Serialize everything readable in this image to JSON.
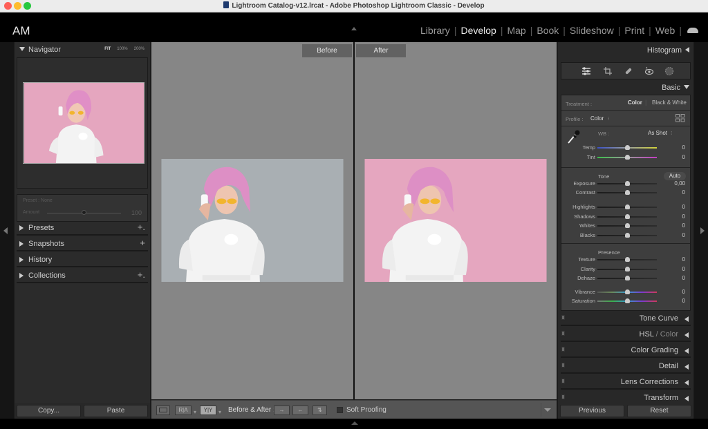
{
  "window": {
    "title": "Lightroom Catalog-v12.lrcat - Adobe Photoshop Lightroom Classic - Develop"
  },
  "header": {
    "identity_plate": "AM",
    "modules": [
      {
        "label": "Library",
        "active": false
      },
      {
        "label": "Develop",
        "active": true
      },
      {
        "label": "Map",
        "active": false
      },
      {
        "label": "Book",
        "active": false
      },
      {
        "label": "Slideshow",
        "active": false
      },
      {
        "label": "Print",
        "active": false
      },
      {
        "label": "Web",
        "active": false
      }
    ],
    "cloud_icon": "cloud-icon"
  },
  "left_panel": {
    "navigator": {
      "title": "Navigator",
      "zoom_options": [
        "FIT",
        "100%",
        "200%"
      ],
      "selected_zoom": "FIT"
    },
    "preset": {
      "label": "Preset : None",
      "amount_label": "Amount",
      "amount_value": "100",
      "amount_fraction": 0.5
    },
    "sections": [
      {
        "label": "Presets",
        "plus": "+."
      },
      {
        "label": "Snapshots",
        "plus": "+"
      },
      {
        "label": "History",
        "plus": ""
      },
      {
        "label": "Collections",
        "plus": "+."
      }
    ],
    "copy_label": "Copy...",
    "paste_label": "Paste"
  },
  "center": {
    "before_label": "Before",
    "after_label": "After",
    "before_bg": "#a9afb3",
    "after_bg": "#e5a6bf"
  },
  "toolbar": {
    "view_loupe": "loupe-view-icon",
    "view_ra": "R|A",
    "view_yy": "Y|Y",
    "before_after_label": "Before & After :",
    "soft_proofing_label": "Soft Proofing",
    "soft_proofing_checked": false
  },
  "right_panel": {
    "histogram_label": "Histogram",
    "tools": [
      "edit-sliders-icon",
      "crop-icon",
      "healing-icon",
      "red-eye-icon",
      "masking-icon"
    ],
    "basic": {
      "title": "Basic",
      "treatment_label": "Treatment :",
      "treatment_options": [
        "Color",
        "Black & White"
      ],
      "treatment_selected": "Color",
      "profile_label": "Profile :",
      "profile_value": "Color",
      "wb_label": "WB :",
      "wb_value": "As Shot",
      "tone_label": "Tone",
      "auto_label": "Auto",
      "presence_label": "Presence",
      "sliders": [
        {
          "name": "Temp",
          "value": "0",
          "pos": 0.5,
          "track": "temp"
        },
        {
          "name": "Tint",
          "value": "0",
          "pos": 0.5,
          "track": "tint"
        },
        {
          "name": "Exposure",
          "value": "0,00",
          "pos": 0.5,
          "track": "dark"
        },
        {
          "name": "Contrast",
          "value": "0",
          "pos": 0.5,
          "track": "dark"
        },
        {
          "name": "Highlights",
          "value": "0",
          "pos": 0.5,
          "track": "dark"
        },
        {
          "name": "Shadows",
          "value": "0",
          "pos": 0.5,
          "track": "dark"
        },
        {
          "name": "Whites",
          "value": "0",
          "pos": 0.5,
          "track": "dark"
        },
        {
          "name": "Blacks",
          "value": "0",
          "pos": 0.5,
          "track": "dark"
        },
        {
          "name": "Texture",
          "value": "0",
          "pos": 0.5,
          "track": "dark"
        },
        {
          "name": "Clarity",
          "value": "0",
          "pos": 0.5,
          "track": "dark"
        },
        {
          "name": "Dehaze",
          "value": "0",
          "pos": 0.5,
          "track": "dark"
        },
        {
          "name": "Vibrance",
          "value": "0",
          "pos": 0.5,
          "track": "vib"
        },
        {
          "name": "Saturation",
          "value": "0",
          "pos": 0.5,
          "track": "sat"
        }
      ]
    },
    "sections": [
      {
        "label": "Tone Curve"
      },
      {
        "label": "HSL",
        "label_dim": " / Color"
      },
      {
        "label": "Color Grading"
      },
      {
        "label": "Detail"
      },
      {
        "label": "Lens Corrections"
      },
      {
        "label": "Transform"
      }
    ],
    "previous_label": "Previous",
    "reset_label": "Reset"
  }
}
